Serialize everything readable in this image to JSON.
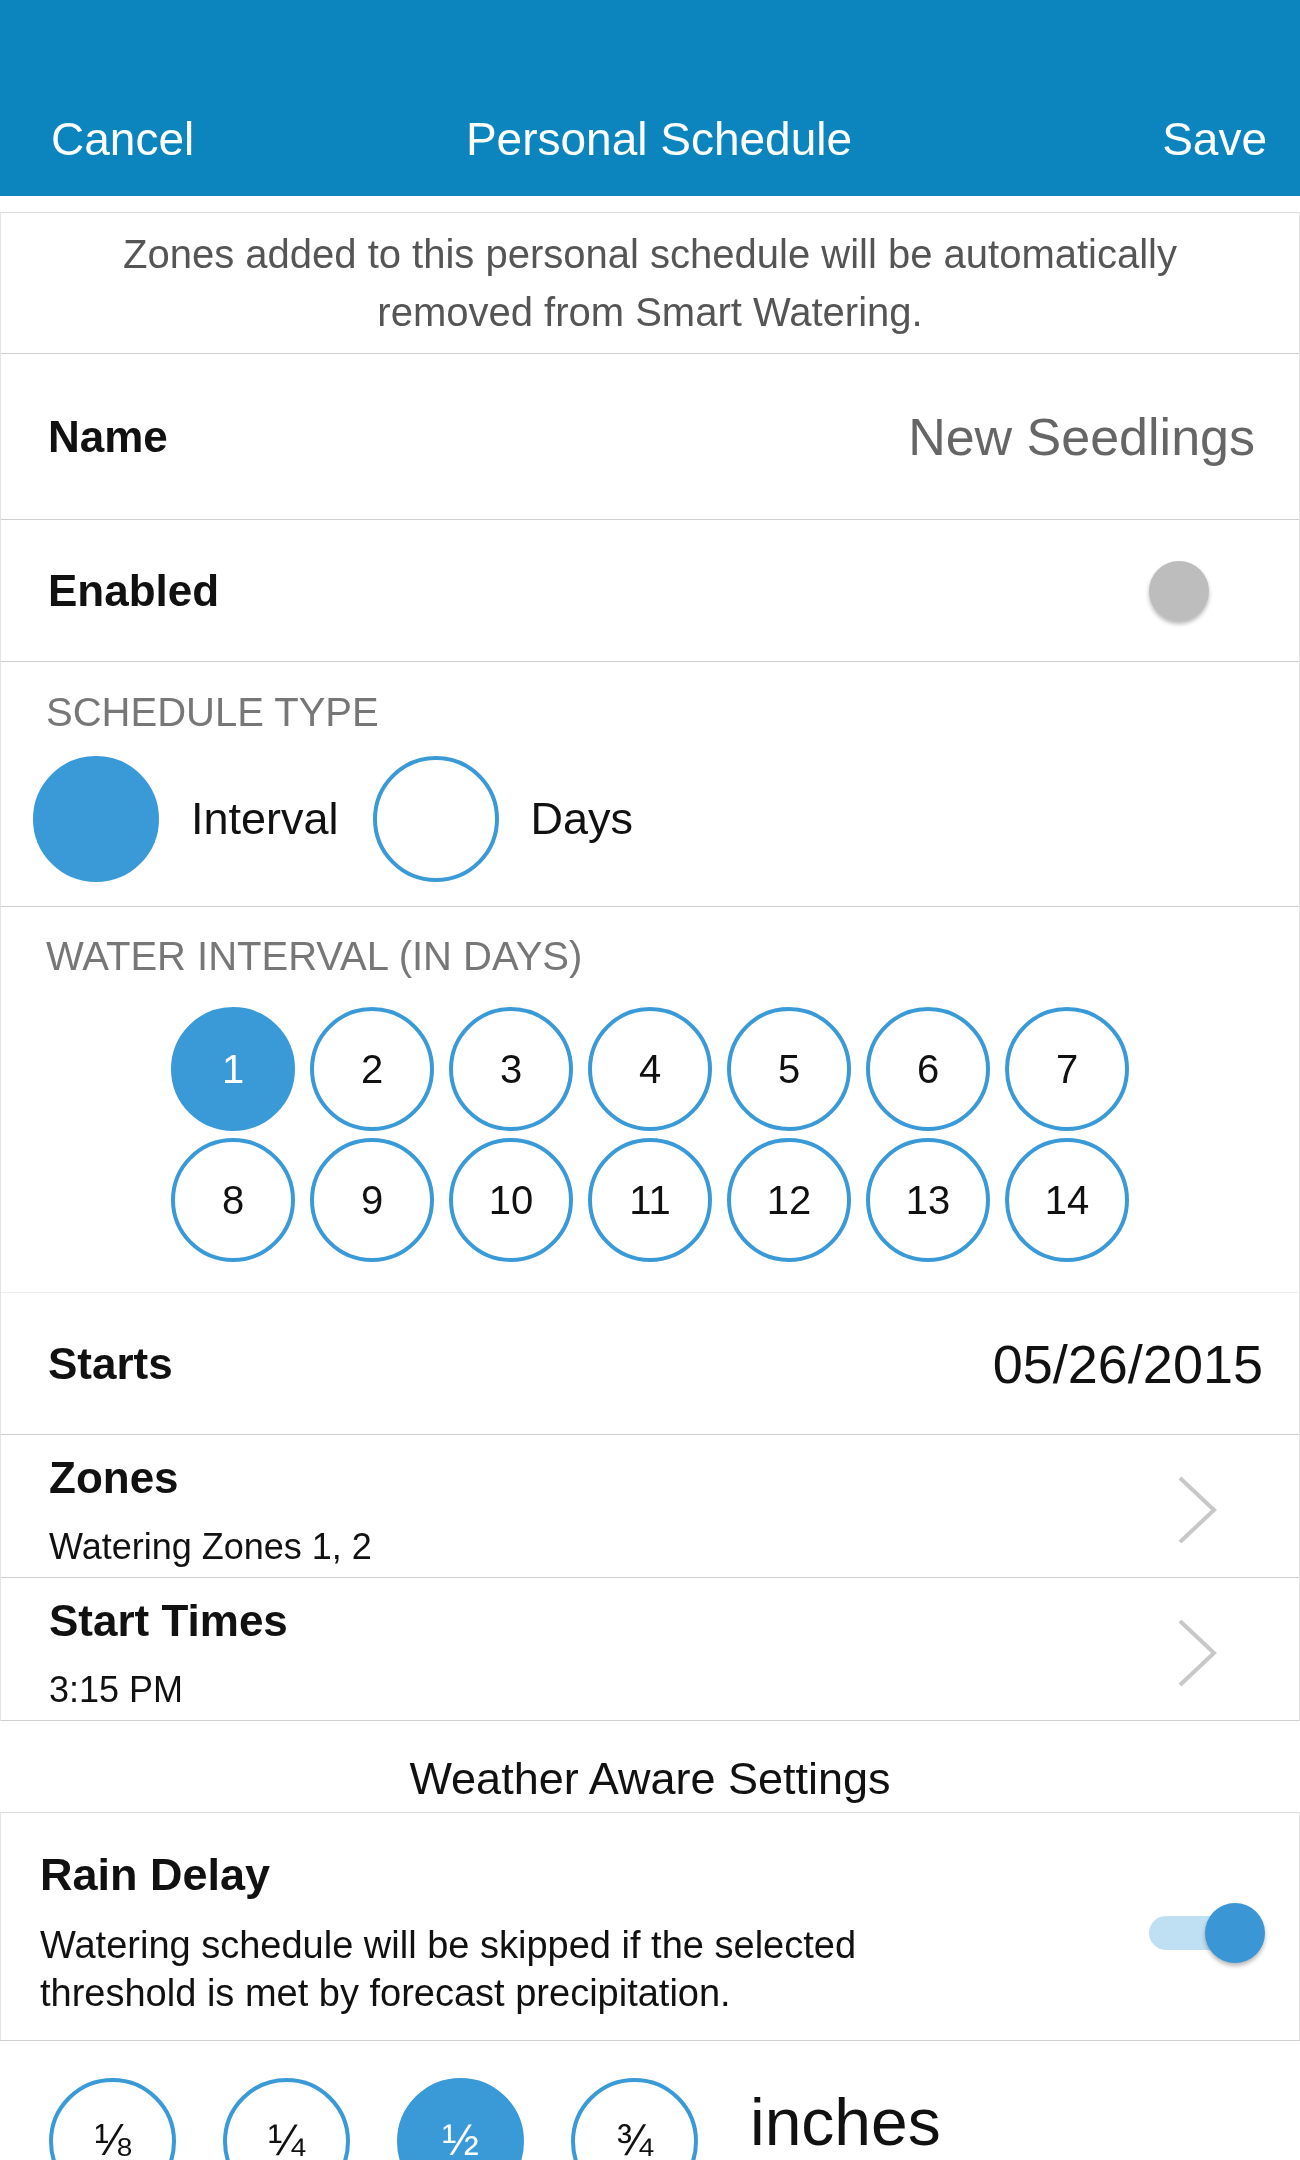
{
  "header": {
    "cancel": "Cancel",
    "title": "Personal Schedule",
    "save": "Save"
  },
  "notice": "Zones added to this personal schedule will be automatically removed from Smart Watering.",
  "name_row": {
    "label": "Name",
    "value": "New Seedlings"
  },
  "enabled_row": {
    "label": "Enabled",
    "on": false
  },
  "schedule_type": {
    "heading": "SCHEDULE TYPE",
    "options": [
      {
        "label": "Interval",
        "selected": true
      },
      {
        "label": "Days",
        "selected": false
      }
    ]
  },
  "water_interval": {
    "heading": "WATER INTERVAL (IN DAYS)",
    "days": [
      {
        "label": "1",
        "selected": true
      },
      {
        "label": "2",
        "selected": false
      },
      {
        "label": "3",
        "selected": false
      },
      {
        "label": "4",
        "selected": false
      },
      {
        "label": "5",
        "selected": false
      },
      {
        "label": "6",
        "selected": false
      },
      {
        "label": "7",
        "selected": false
      },
      {
        "label": "8",
        "selected": false
      },
      {
        "label": "9",
        "selected": false
      },
      {
        "label": "10",
        "selected": false
      },
      {
        "label": "11",
        "selected": false
      },
      {
        "label": "12",
        "selected": false
      },
      {
        "label": "13",
        "selected": false
      },
      {
        "label": "14",
        "selected": false
      }
    ]
  },
  "starts_row": {
    "label": "Starts",
    "value": "05/26/2015"
  },
  "detail_rows": [
    {
      "label": "Zones",
      "value": "Watering Zones 1, 2"
    },
    {
      "label": "Start Times",
      "value": "3:15 PM"
    }
  ],
  "weather_heading": "Weather Aware Settings",
  "rain_delay": {
    "label": "Rain Delay",
    "description": "Watering schedule will be skipped if the selected threshold is met by forecast precipitation.",
    "on": true
  },
  "threshold": {
    "options": [
      {
        "label": "⅛",
        "selected": false
      },
      {
        "label": "¼",
        "selected": false
      },
      {
        "label": "½",
        "selected": true
      },
      {
        "label": "¾",
        "selected": false
      }
    ],
    "unit": "inches"
  }
}
